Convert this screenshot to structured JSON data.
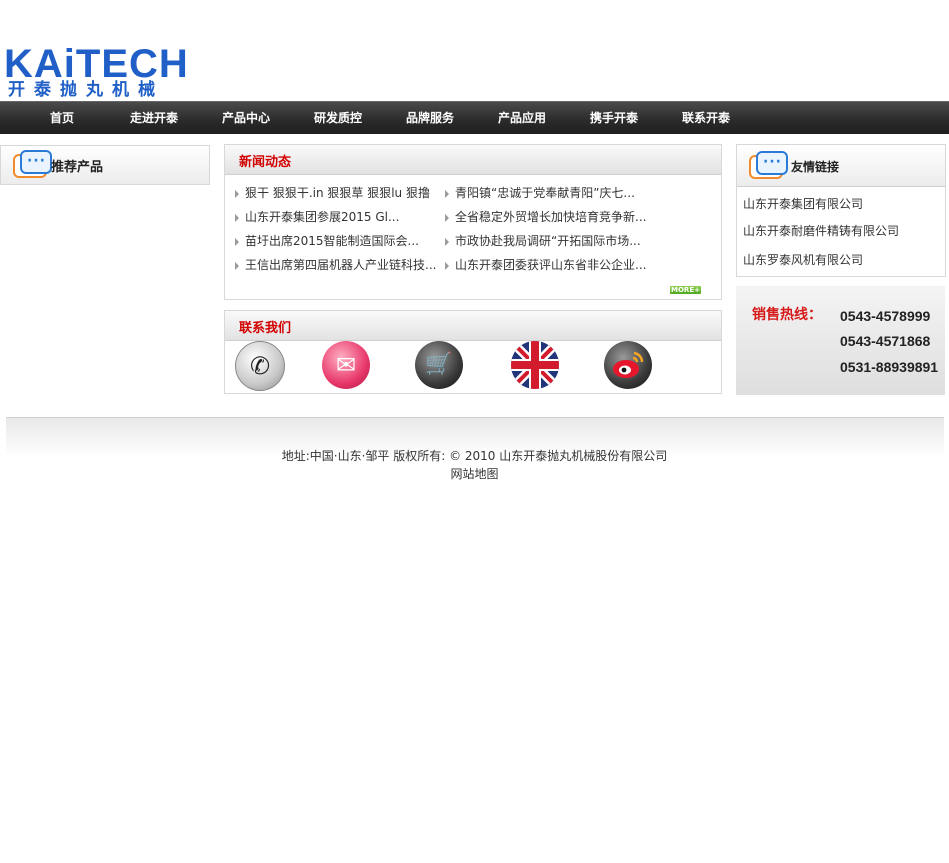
{
  "logo": {
    "brand": "KAiTECH",
    "sub": "开泰抛丸机械"
  },
  "nav": [
    "首页",
    "走进开泰",
    "产品中心",
    "研发质控",
    "品牌服务",
    "产品应用",
    "携手开泰",
    "联系开泰"
  ],
  "left_box": {
    "title": "推荐产品"
  },
  "news": {
    "title": "新闻动态",
    "col1": [
      "狠干 狠狠干.in 狠狠草 狠狠lu 狠撸",
      "山东开泰集团参展2015 Gl...",
      "苗圩出席2015智能制造国际会...",
      "王信出席第四届机器人产业链科技..."
    ],
    "col2": [
      "青阳镇“忠诚于党奉献青阳”庆七...",
      "全省稳定外贸增长加快培育竞争新...",
      "市政协赴我局调研“开拓国际市场...",
      "山东开泰团委获评山东省非公企业..."
    ],
    "more": "MORE+"
  },
  "contact": {
    "title": "联系我们"
  },
  "friends": {
    "title": "友情链接",
    "links": [
      "山东开泰集团有限公司",
      "山东开泰耐磨件精铸有限公司",
      "山东罗泰风机有限公司"
    ]
  },
  "hotline": {
    "label": "销售热线：",
    "numbers": [
      "0543-4578999",
      "0543-4571868",
      "0531-88939891"
    ]
  },
  "footer": {
    "text": "地址:中国·山东·邹平 版权所有: © 2010 山东开泰抛丸机械股份有限公司",
    "sitemap": "网站地图"
  }
}
